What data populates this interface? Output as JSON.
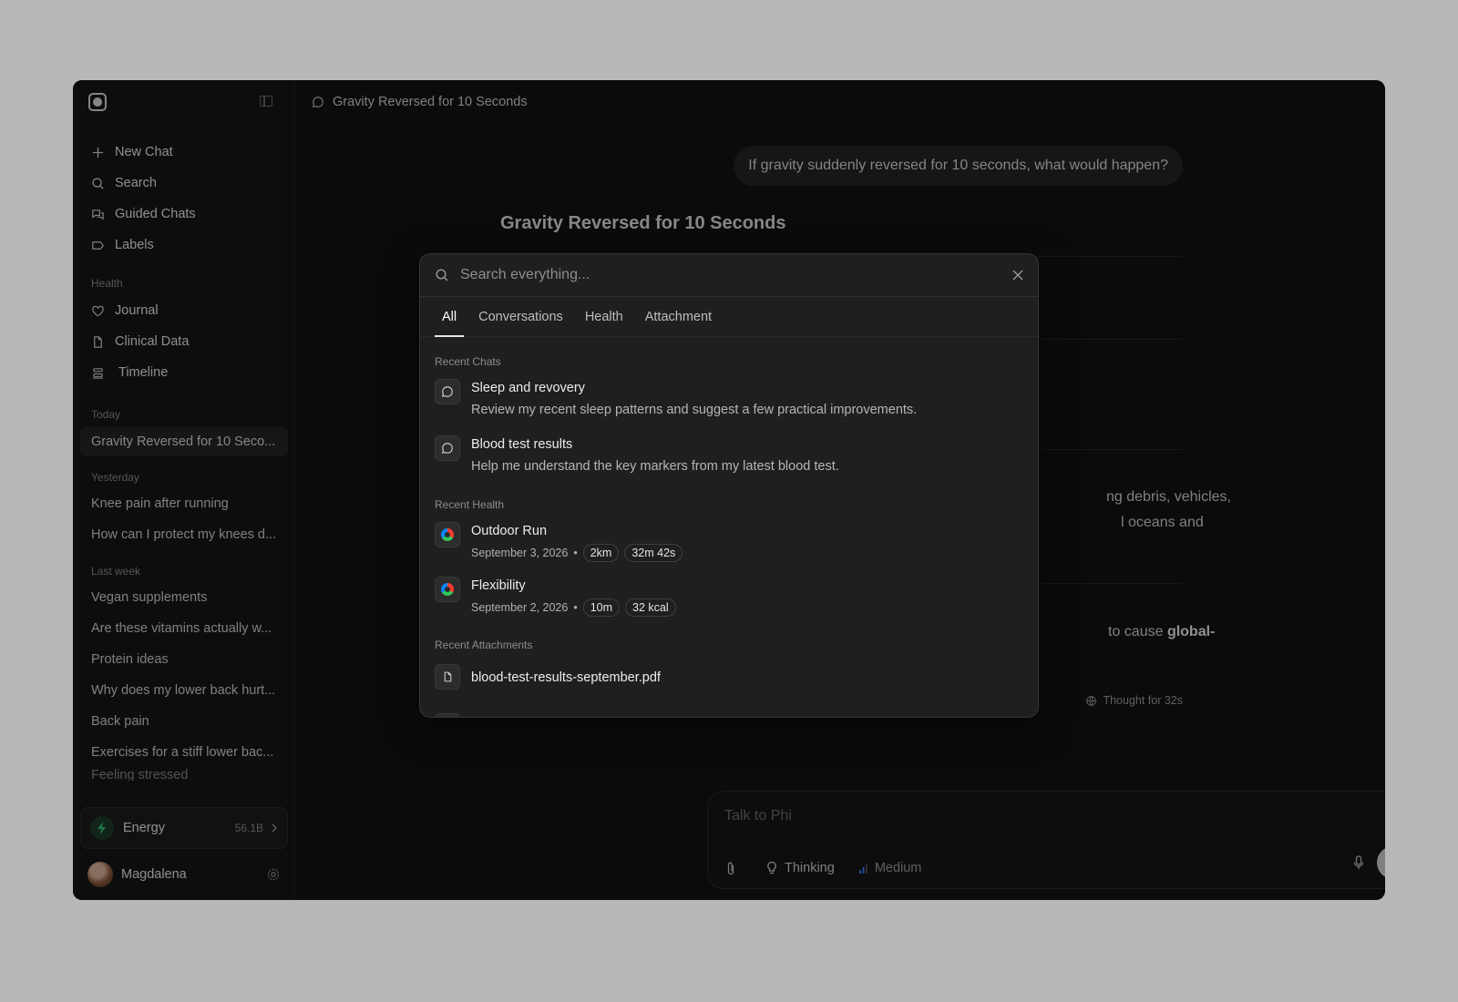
{
  "sidebar": {
    "nav": [
      {
        "label": "New Chat",
        "icon": "plus-icon"
      },
      {
        "label": "Search",
        "icon": "search-icon"
      },
      {
        "label": "Guided Chats",
        "icon": "chat-bubbles-icon"
      },
      {
        "label": "Labels",
        "icon": "label-icon"
      }
    ],
    "health_label": "Health",
    "health": [
      {
        "label": "Journal",
        "icon": "heart-icon"
      },
      {
        "label": "Clinical Data",
        "icon": "document-icon"
      },
      {
        "label": "Timeline",
        "icon": "timeline-icon"
      }
    ],
    "today_label": "Today",
    "today": [
      "Gravity Reversed for 10 Seco..."
    ],
    "yesterday_label": "Yesterday",
    "yesterday": [
      "Knee pain after running",
      "How can I protect my knees d..."
    ],
    "lastweek_label": "Last week",
    "lastweek": [
      "Vegan supplements",
      "Are these vitamins actually w...",
      "Protein ideas",
      "Why does my lower back hurt...",
      "Back pain",
      "Exercises for a stiff lower bac...",
      "Feeling stressed"
    ],
    "energy": {
      "label": "Energy",
      "value": "56.1B",
      "color": "#2fbf71"
    },
    "user": {
      "name": "Magdalena"
    }
  },
  "chat": {
    "title": "Gravity Reversed for 10 Seconds",
    "user_message": "If gravity suddenly reversed for 10 seconds, what would happen?",
    "answer_title": "Gravity Reversed for 10 Seconds",
    "fragment_1a": "ng debris, vehicles,",
    "fragment_1b": "l oceans and",
    "fragment_2a": "to cause ",
    "fragment_2b": "global-",
    "thought": "Thought for 32s",
    "composer_placeholder": "Talk to Phi",
    "tool_thinking": "Thinking",
    "tool_medium": "Medium"
  },
  "search": {
    "placeholder": "Search everything...",
    "tabs": [
      "All",
      "Conversations",
      "Health",
      "Attachment"
    ],
    "active_tab": "All",
    "recent_chats_label": "Recent Chats",
    "recent_chats": [
      {
        "title": "Sleep and revovery",
        "subtitle": "Review my recent sleep patterns and suggest a few practical improvements."
      },
      {
        "title": "Blood test results",
        "subtitle": "Help me understand the key markers from my latest blood test."
      }
    ],
    "recent_health_label": "Recent Health",
    "recent_health": [
      {
        "title": "Outdoor Run",
        "date": "September 3, 2026",
        "chips": [
          "2km",
          "32m 42s"
        ]
      },
      {
        "title": "Flexibility",
        "date": "September 2, 2026",
        "chips": [
          "10m",
          "32 kcal"
        ]
      }
    ],
    "recent_attachments_label": "Recent Attachments",
    "recent_attachments": [
      {
        "name": "blood-test-results-september.pdf"
      }
    ]
  }
}
